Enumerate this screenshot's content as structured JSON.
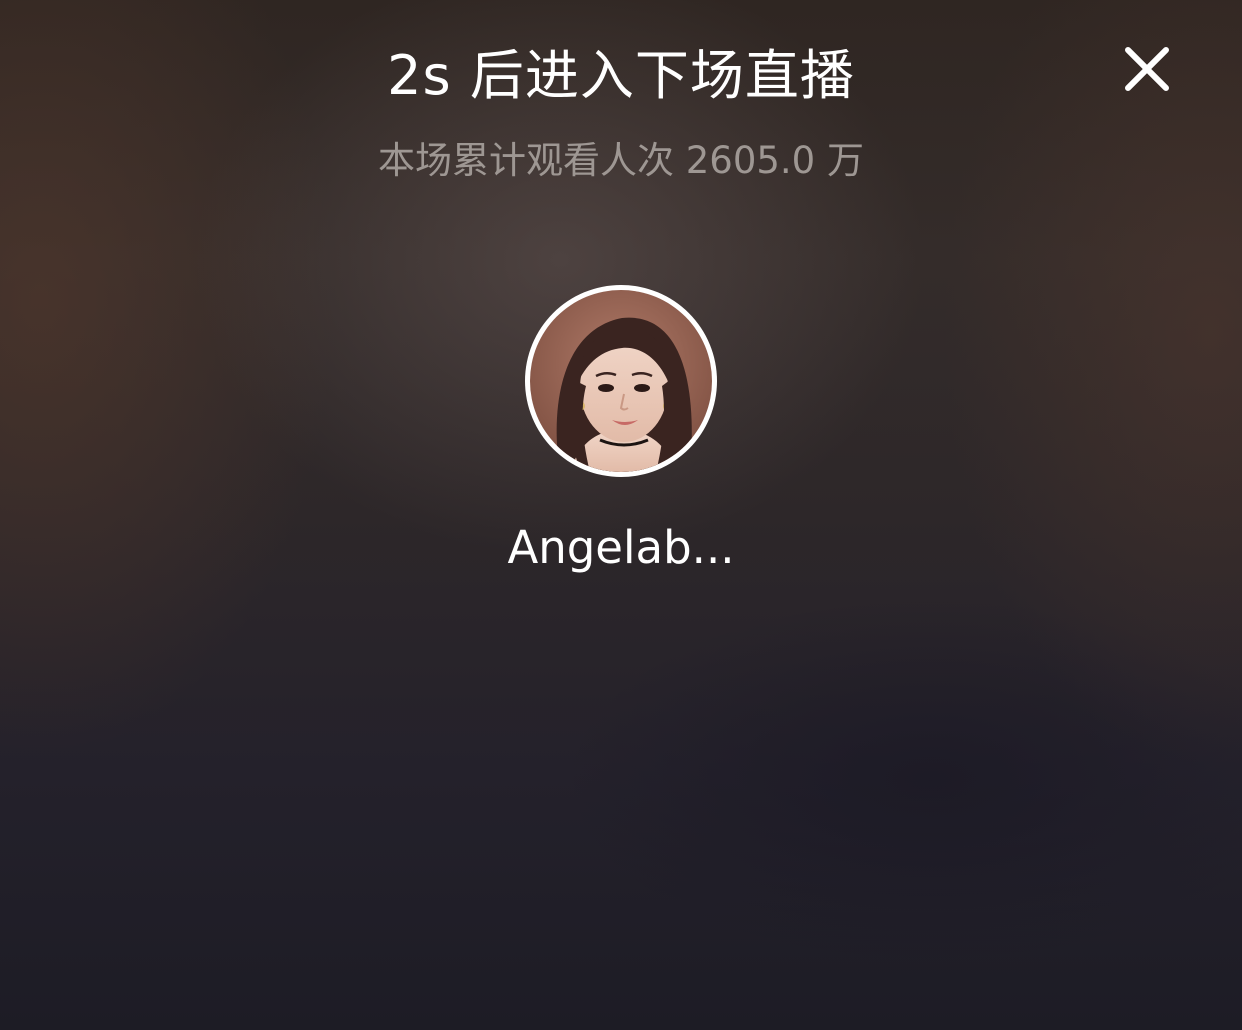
{
  "countdown": {
    "title": "2s 后进入下场直播"
  },
  "stats": {
    "viewers_text": "本场累计观看人次 2605.0 万"
  },
  "streamer": {
    "name": "Angelab..."
  },
  "controls": {
    "close_icon": "close-icon"
  },
  "colors": {
    "title": "#ffffff",
    "subtitle": "#9e9793",
    "background": "#2d2729"
  }
}
